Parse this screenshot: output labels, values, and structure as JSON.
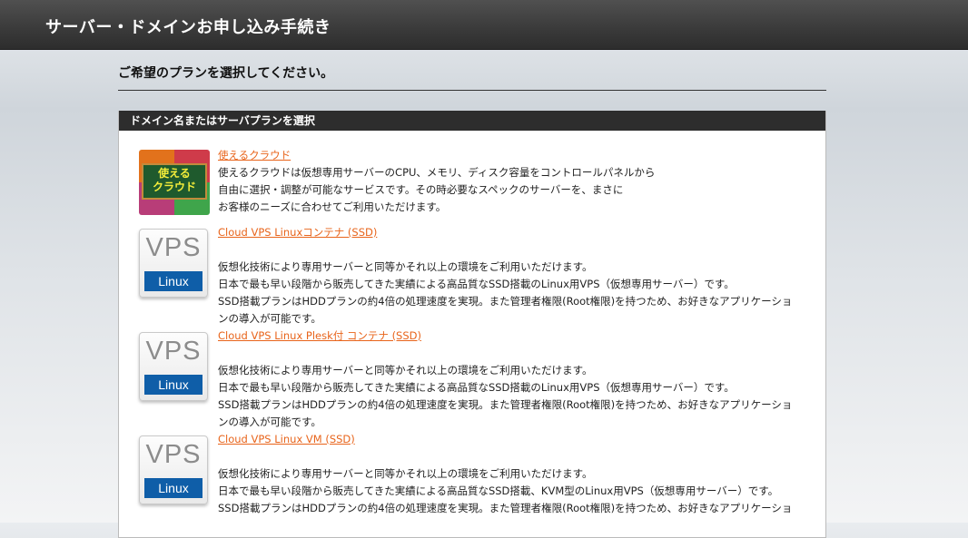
{
  "header": {
    "title": "サーバー・ドメインお申し込み手続き"
  },
  "page": {
    "heading": "ご希望のプランを選択してください。"
  },
  "panel": {
    "title": "ドメイン名またはサーバプランを選択"
  },
  "plans": [
    {
      "name": "使えるクラウド",
      "icon_text_line1": "使える",
      "icon_text_line2": "クラウド",
      "description": [
        "使えるクラウドは仮想専用サーバーのCPU、メモリ、ディスク容量をコントロールパネルから",
        "自由に選択・調整が可能なサービスです。その時必要なスペックのサーバーを、まさに",
        "お客様のニーズに合わせてご利用いただけます。"
      ]
    },
    {
      "name": "Cloud VPS Linuxコンテナ (SSD)",
      "icon_word": "VPS",
      "icon_os": "Linux",
      "description": [
        "仮想化技術により専用サーバーと同等かそれ以上の環境をご利用いただけます。",
        "日本で最も早い段階から販売してきた実績による高品質なSSD搭載のLinux用VPS（仮想専用サーバー）です。",
        "SSD搭載プランはHDDプランの約4倍の処理速度を実現。また管理者権限(Root権限)を持つため、お好きなアプリケーショ",
        "ンの導入が可能です。"
      ]
    },
    {
      "name": "Cloud VPS Linux Plesk付 コンテナ (SSD)",
      "icon_word": "VPS",
      "icon_os": "Linux",
      "description": [
        "仮想化技術により専用サーバーと同等かそれ以上の環境をご利用いただけます。",
        "日本で最も早い段階から販売してきた実績による高品質なSSD搭載のLinux用VPS（仮想専用サーバー）です。",
        "SSD搭載プランはHDDプランの約4倍の処理速度を実現。また管理者権限(Root権限)を持つため、お好きなアプリケーショ",
        "ンの導入が可能です。"
      ]
    },
    {
      "name": "Cloud VPS Linux VM (SSD)",
      "icon_word": "VPS",
      "icon_os": "Linux",
      "description": [
        "仮想化技術により専用サーバーと同等かそれ以上の環境をご利用いただけます。",
        "日本で最も早い段階から販売してきた実績による高品質なSSD搭載、KVM型のLinux用VPS（仮想専用サーバー）です。",
        "SSD搭載プランはHDDプランの約4倍の処理速度を実現。また管理者権限(Root権限)を持つため、お好きなアプリケーショ"
      ]
    }
  ]
}
